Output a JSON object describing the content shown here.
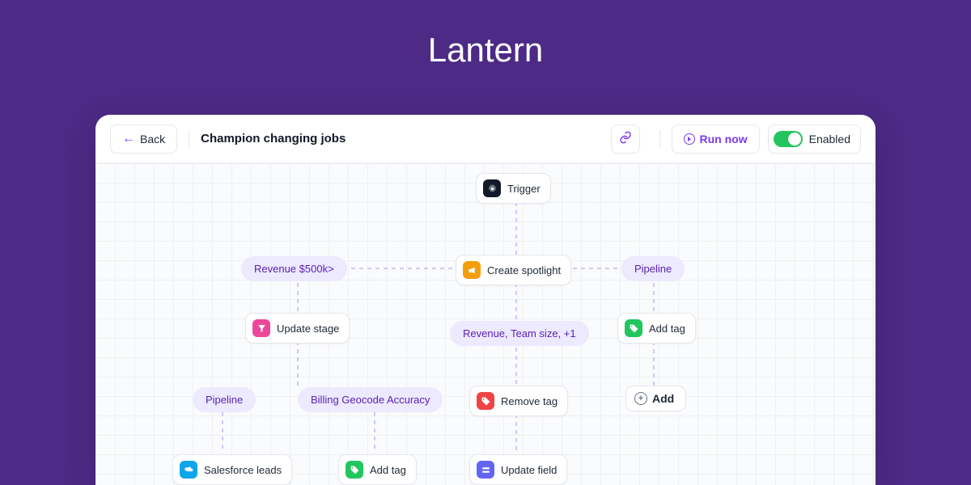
{
  "hero": {
    "title": "Lantern"
  },
  "toolbar": {
    "back": "Back",
    "title": "Champion changing jobs",
    "run": "Run now",
    "enabled": "Enabled"
  },
  "nodes": {
    "trigger": "Trigger",
    "create_spotlight": "Create spotlight",
    "update_stage": "Update stage",
    "add_tag": "Add tag",
    "remove_tag": "Remove tag",
    "salesforce_leads": "Salesforce leads",
    "add_tag2": "Add tag",
    "update_field": "Update field",
    "add": "Add"
  },
  "pills": {
    "revenue_500k": "Revenue $500k>",
    "pipeline1": "Pipeline",
    "revenue_team": "Revenue, Team size, +1",
    "pipeline2": "Pipeline",
    "billing": "Billing Geocode Accuracy"
  }
}
